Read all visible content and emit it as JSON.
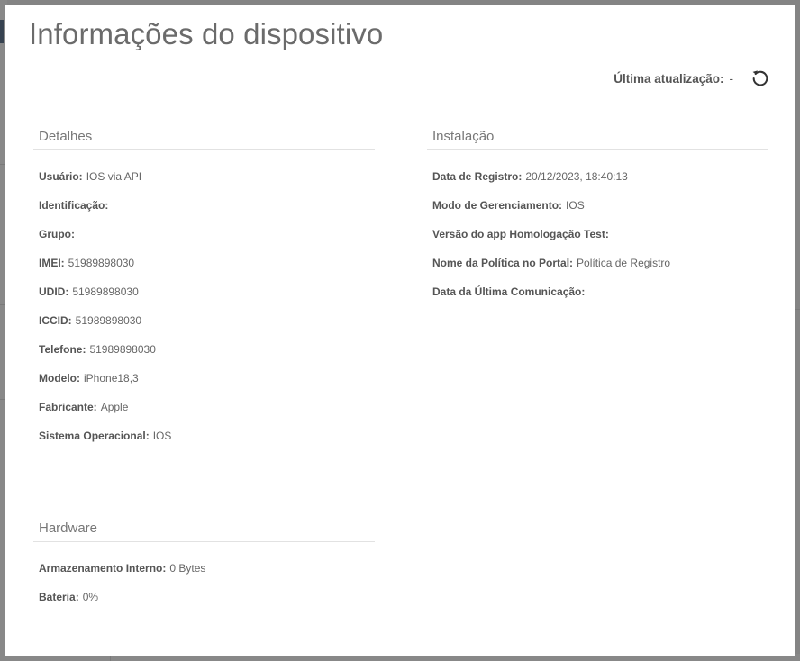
{
  "modal": {
    "title": "Informações do dispositivo",
    "last_update_label": "Última atualização:",
    "last_update_value": "-",
    "refresh_icon": "refresh-icon"
  },
  "details": {
    "title": "Detalhes",
    "rows": [
      {
        "label": "Usuário:",
        "value": "IOS via API"
      },
      {
        "label": "Identificação:",
        "value": ""
      },
      {
        "label": "Grupo:",
        "value": ""
      },
      {
        "label": "IMEI:",
        "value": "51989898030"
      },
      {
        "label": "UDID:",
        "value": "51989898030"
      },
      {
        "label": "ICCID:",
        "value": "51989898030"
      },
      {
        "label": "Telefone:",
        "value": "51989898030"
      },
      {
        "label": "Modelo:",
        "value": "iPhone18,3"
      },
      {
        "label": "Fabricante:",
        "value": "Apple"
      },
      {
        "label": "Sistema Operacional:",
        "value": "IOS"
      }
    ]
  },
  "installation": {
    "title": "Instalação",
    "rows": [
      {
        "label": "Data de Registro:",
        "value": "20/12/2023, 18:40:13"
      },
      {
        "label": "Modo de Gerenciamento:",
        "value": "IOS"
      },
      {
        "label": "Versão do app Homologação Test:",
        "value": ""
      },
      {
        "label": "Nome da Política no Portal:",
        "value": "Política de Registro"
      },
      {
        "label": "Data da Última Comunicação:",
        "value": ""
      }
    ]
  },
  "hardware": {
    "title": "Hardware",
    "rows": [
      {
        "label": "Armazenamento Interno:",
        "value": "0 Bytes"
      },
      {
        "label": "Bateria:",
        "value": "0%"
      }
    ]
  }
}
